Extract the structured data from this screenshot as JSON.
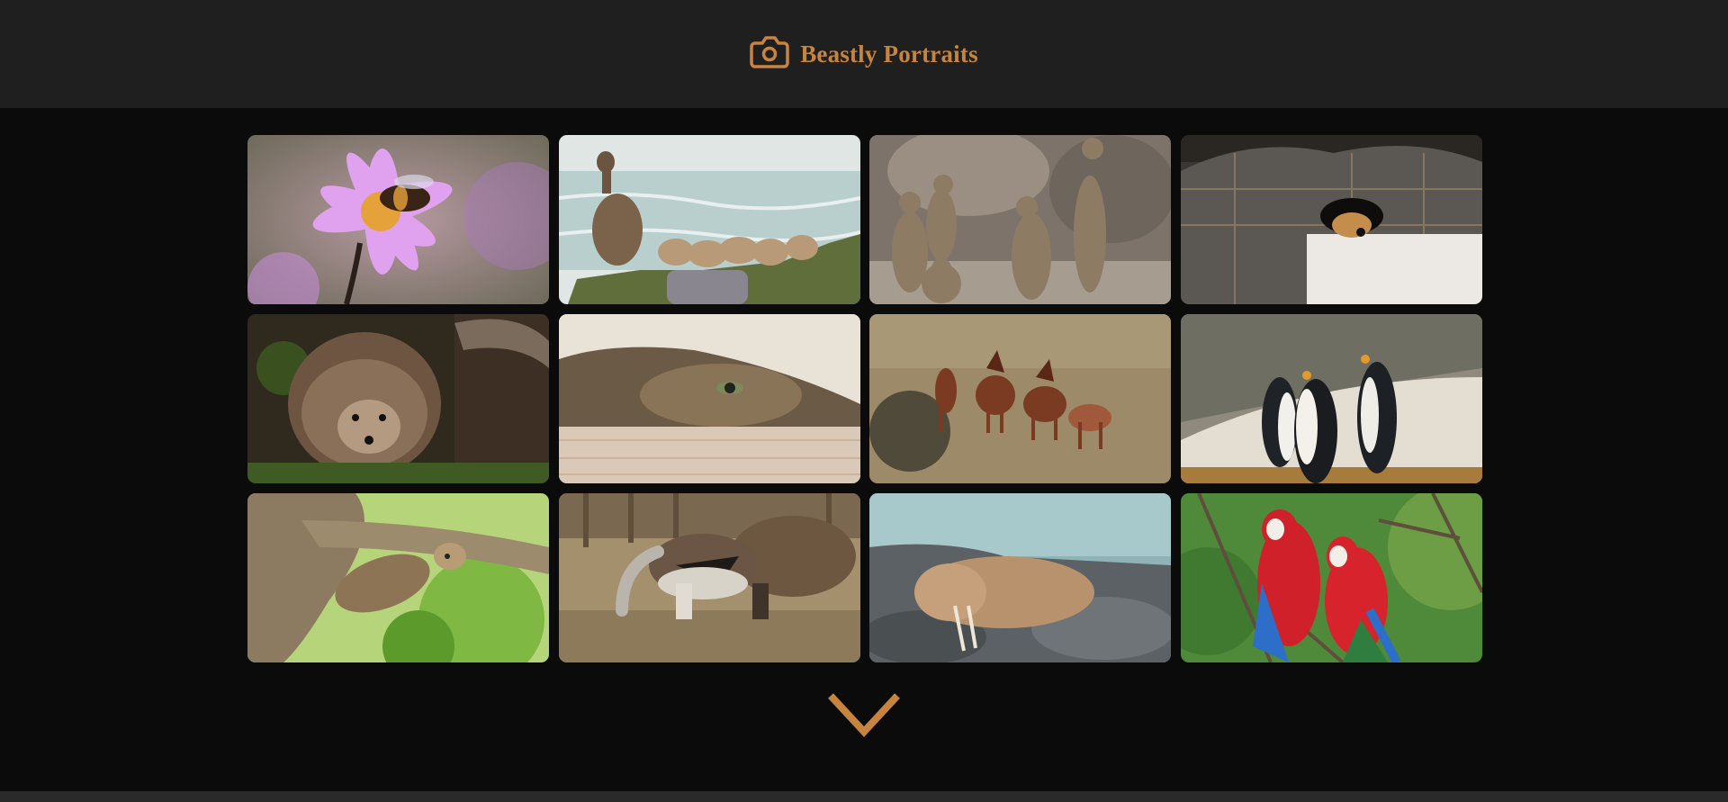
{
  "header": {
    "title": "Beastly Portraits",
    "logo_icon": "camera-icon",
    "accent_color": "#c7843f",
    "background": "#1f1f1f"
  },
  "gallery": {
    "tiles": [
      {
        "subject": "bee-on-purple-flower"
      },
      {
        "subject": "duck-with-ducklings"
      },
      {
        "subject": "meerkats"
      },
      {
        "subject": "dog-under-blanket"
      },
      {
        "subject": "hedgehog"
      },
      {
        "subject": "cat-under-blanket"
      },
      {
        "subject": "horses-on-hillside"
      },
      {
        "subject": "penguins"
      },
      {
        "subject": "sloth-in-tree"
      },
      {
        "subject": "anteater"
      },
      {
        "subject": "walrus-on-rocks"
      },
      {
        "subject": "macaw-parrots"
      }
    ]
  },
  "pager": {
    "icon": "chevron-down-icon"
  }
}
